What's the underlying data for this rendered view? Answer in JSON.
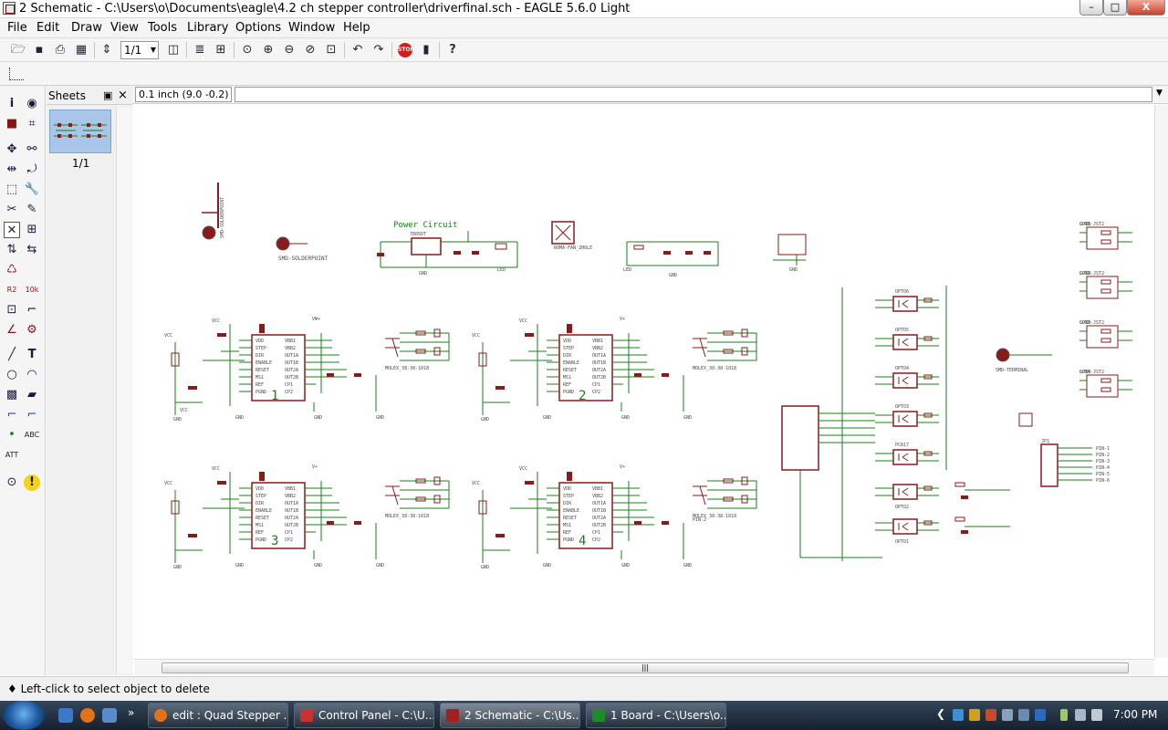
{
  "window": {
    "title": "2 Schematic - C:\\Users\\o\\Documents\\eagle\\4.2 ch stepper controller\\driverfinal.sch - EAGLE 5.6.0 Light",
    "controls": {
      "minimize": "–",
      "maximize": "□",
      "close": "X"
    }
  },
  "menu": [
    "File",
    "Edit",
    "Draw",
    "View",
    "Tools",
    "Library",
    "Options",
    "Window",
    "Help"
  ],
  "toolbar": {
    "zoom_select": "1/1"
  },
  "sheets_panel": {
    "title": "Sheets",
    "sheet_label": "1/1",
    "float_glyph": "▣",
    "close_glyph": "×"
  },
  "coordinates": "0.1 inch (9.0 -0.2)",
  "status": "♦ Left-click to select object to delete",
  "schematic": {
    "power_circuit_label": "Power Circuit",
    "module_numbers": [
      "1",
      "2",
      "3",
      "4"
    ],
    "labels": [
      "SMD-SOLDERPOINT",
      "SMD-SOLDERPOINT",
      "ROMA-FAN_2HOLE",
      "7805DT",
      "LED",
      "LED",
      "GND",
      "GND",
      "GND",
      "VCC",
      "V+",
      "OPTO6",
      "OPTO5",
      "OPTO4",
      "OPTO3",
      "OPTO2",
      "OPTO1",
      "PC817",
      "SMD-TERMINAL",
      "CON1",
      "CON2",
      "CON3",
      "CON4",
      "JP1",
      "MOLEX_38-38-1018",
      "PIN-1",
      "PIN-2",
      "PIN-3",
      "PIN-4",
      "PIN-5",
      "PIN-6"
    ],
    "colors": {
      "wire": "#1a7f1a",
      "part": "#8b1a1a",
      "text": "#4a4a4a"
    }
  },
  "taskbar": {
    "buttons": [
      {
        "label": "edit : Quad Stepper ...",
        "icon_color": "#e0731a"
      },
      {
        "label": "Control Panel - C:\\U...",
        "icon_color": "#c83232"
      },
      {
        "label": "2 Schematic - C:\\Us...",
        "icon_color": "#a32020",
        "active": true
      },
      {
        "label": "1 Board - C:\\Users\\o...",
        "icon_color": "#1f8a2a"
      }
    ],
    "clock": "7:00 PM"
  }
}
